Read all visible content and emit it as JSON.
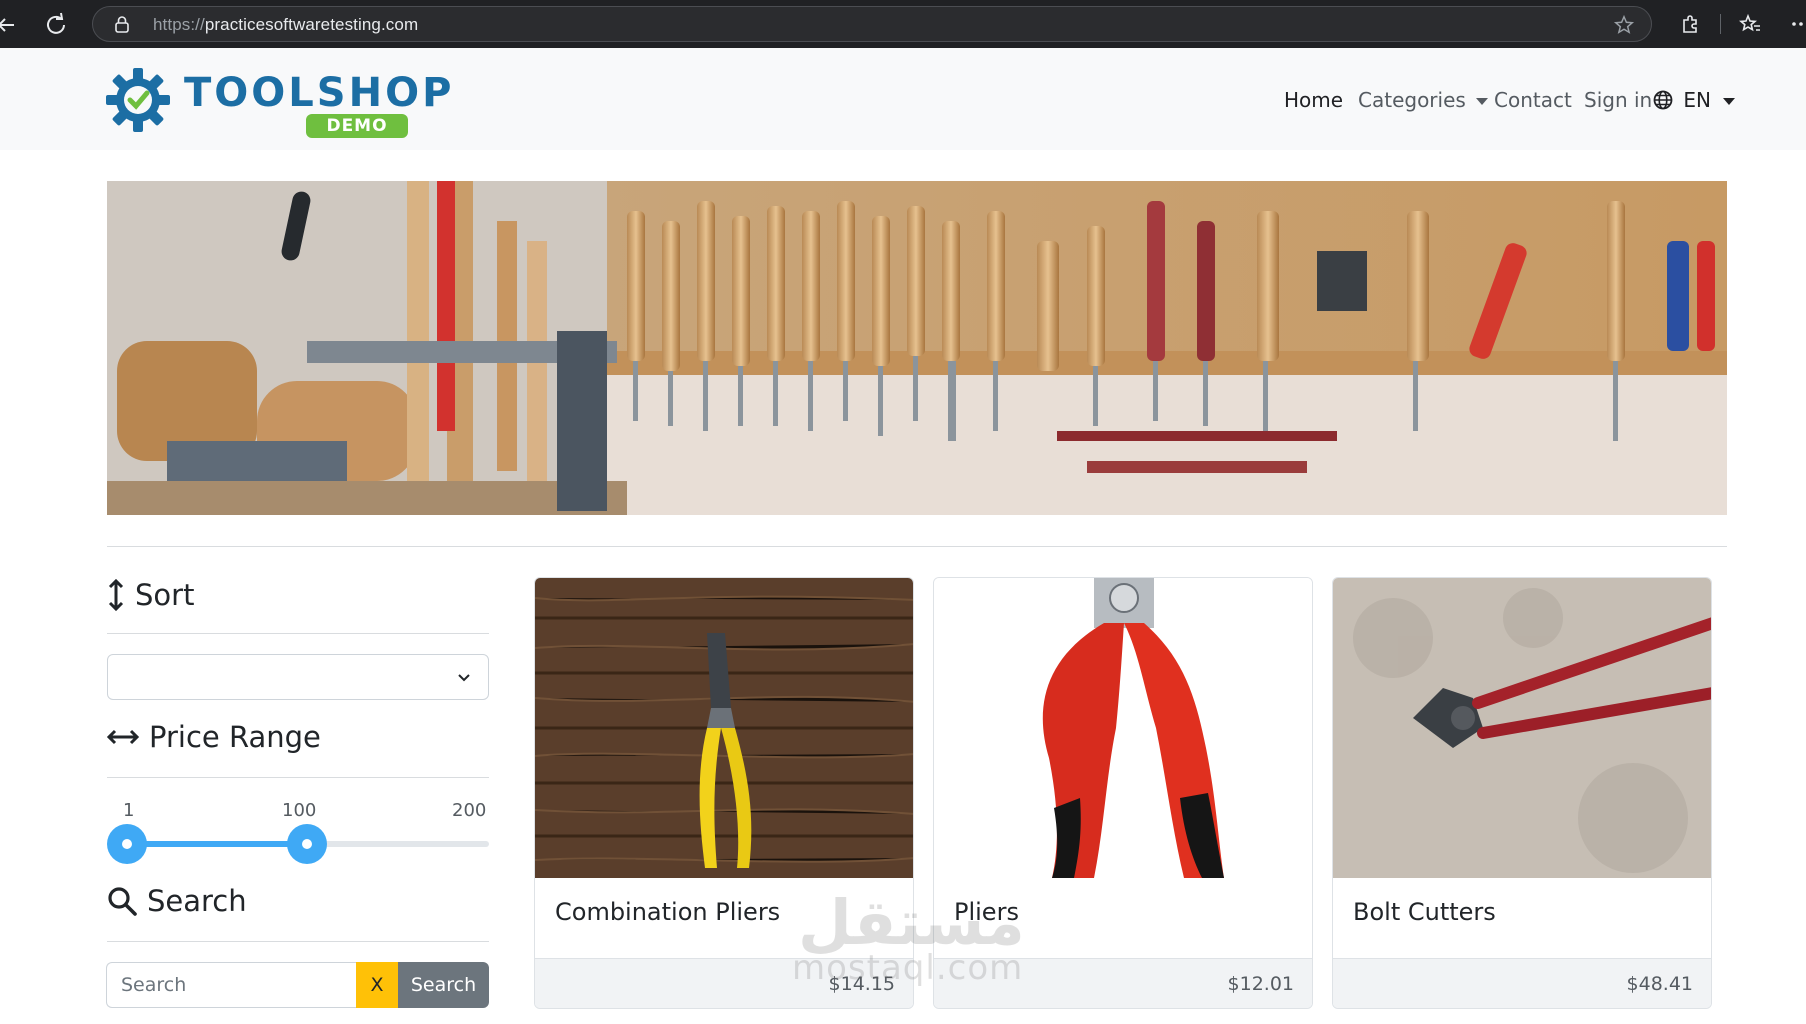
{
  "browser": {
    "url_protocol": "https://",
    "url_host": "practicesoftwaretesting.com"
  },
  "brand": {
    "logo_text": "TOOLSHOP",
    "logo_badge": "DEMO",
    "colors": {
      "logo_blue": "#1c6ea4",
      "badge_green": "#6fbf3f",
      "accent": "#3fa9f5"
    }
  },
  "nav": {
    "home": "Home",
    "categories": "Categories",
    "contact": "Contact",
    "sign_in": "Sign in",
    "language": "EN"
  },
  "sidebar": {
    "sort_title": "Sort",
    "sort_selected": "",
    "price_title": "Price Range",
    "price": {
      "min": "1",
      "current": "100",
      "max": "200",
      "value_fraction": 0.497
    },
    "search_title": "Search",
    "search_placeholder": "Search",
    "clear_button": "X",
    "search_button": "Search"
  },
  "products": [
    {
      "name": "Combination Pliers",
      "price": "$14.15"
    },
    {
      "name": "Pliers",
      "price": "$12.01"
    },
    {
      "name": "Bolt Cutters",
      "price": "$48.41"
    }
  ],
  "watermark": {
    "line1": "مستقل",
    "line2": "mostaql.com"
  }
}
